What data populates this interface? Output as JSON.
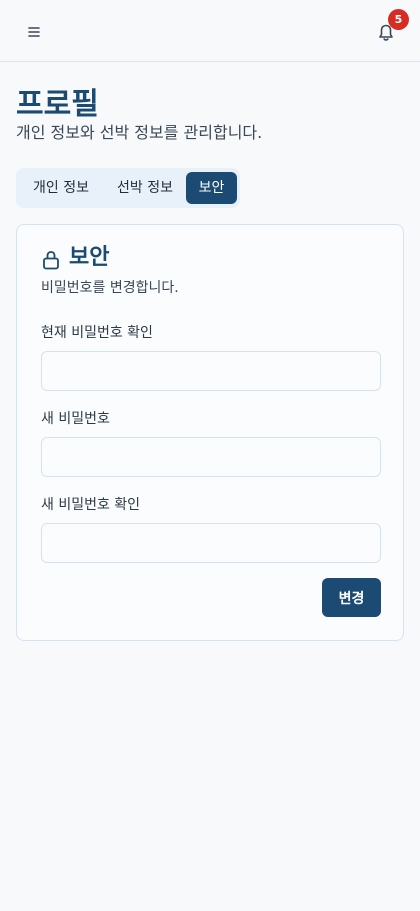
{
  "header": {
    "menu_icon": "hamburger-menu-icon",
    "bell_icon": "bell-icon",
    "notification_count": "5",
    "badge_color": "#d62c24"
  },
  "page": {
    "title": "프로필",
    "subtitle": "개인 정보와 선박 정보를 관리합니다."
  },
  "tabs": [
    {
      "label": "개인 정보",
      "active": false
    },
    {
      "label": "선박 정보",
      "active": false
    },
    {
      "label": "보안",
      "active": true
    }
  ],
  "security_card": {
    "icon": "lock-icon",
    "title": "보안",
    "description": "비밀번호를 변경합니다.",
    "fields": [
      {
        "label": "현재 비밀번호 확인",
        "value": ""
      },
      {
        "label": "새 비밀번호",
        "value": ""
      },
      {
        "label": "새 비밀번호 확인",
        "value": ""
      }
    ],
    "submit_label": "변경"
  },
  "colors": {
    "primary": "#1b4a72",
    "background": "#f8f9fb",
    "tab_background": "#e8f1f9",
    "border": "#d5e3f0"
  }
}
